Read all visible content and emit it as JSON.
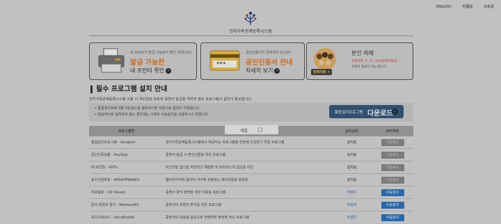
{
  "languages": [
    "ENGLISH",
    "中國語",
    "日本語"
  ],
  "site_title": "전자가족관계등록시스템",
  "banners": [
    {
      "question": "내 프린터가 발급 가능한지 확인 하셨나요?",
      "headline": "발급 가능한",
      "sub": "내 프린터 확인"
    },
    {
      "question": "공인인증서가 준비되어 있나요?",
      "headline": "공인인증서 안내",
      "sub": "자세히 보기"
    },
    {
      "headline": "본인 외에",
      "line2": "형제자매, 부, 모, 자녀(형제자매)의",
      "line3": "증명서 발급이 가능 합니다.",
      "badge": "형제자매 ×"
    }
  ],
  "section": {
    "title": "필수 프로그램 설치 안내",
    "desc": "전자가족관계등록시스템 이용 시 개인정보 보호와 증명서 발급을 위하여 필수 프로그램의 설치가 필요합니다.",
    "notices": [
      "통합설치프로그램 다운로드를 클릭하시면 자동으로 설치가 진행됩니다.",
      "정상적으로 설치하지 않는 경우에는 아래의 수동설치를 사용하시기 바랍니다."
    ],
    "download_small": "통합설치프로그램",
    "download_big": "다운로드"
  },
  "table": {
    "headers": [
      "프로그램명",
      "개요",
      "설치상태",
      "정부처명"
    ],
    "rows": [
      {
        "name": "통합설치프로그램 - Veraport",
        "desc": "전자가족관계등록시스템에서 제공하는 프로그램을 한번에 다운받기 위한 프로그램",
        "status": "설치됨",
        "action": "다운로드",
        "installed": true
      },
      {
        "name": "공인인증모듈 - AnySign",
        "desc": "증명서 발급 시 본인인증을 위한 프로그램",
        "status": "설치됨",
        "action": "다운로드",
        "installed": true
      },
      {
        "name": "PC보안툴 - ASTx",
        "desc": "비인가된 접근을 차단하고 해킹툴 및 바이러스의 접근을 차단",
        "status": "설치됨",
        "action": "다운로드",
        "installed": true
      },
      {
        "name": "송수신암호화 - INISAFEWebEX",
        "desc": "웹브라우저와 웹서버 사이에 전송되는 데이터들을 암호화",
        "status": "설치됨",
        "action": "다운로드",
        "installed": true
      },
      {
        "name": "리포팅툴 - OZ Viewer",
        "desc": "증명서 양식 출력을 위한 리포팅 프로그램",
        "status": "미설치",
        "action": "수동설치",
        "installed": false
      },
      {
        "name": "문서 위변조 방지 - MarkanyNX",
        "desc": "증명서의 위변조 방지를 위한 프로그램",
        "status": "미설치",
        "action": "수동설치",
        "installed": false
      },
      {
        "name": "보이스바코드 - VoiceEyeNX",
        "desc": "증명서의 내용을 음성으로 변환하여 출력해 주는 프로그램",
        "status": "미설치",
        "action": "수동설치",
        "installed": false
      }
    ]
  },
  "loading_text": "개발",
  "colors": {
    "accent_orange": "#ee7b1c",
    "download_button": "#3a5c7f",
    "manual_install": "#2b79c6"
  }
}
